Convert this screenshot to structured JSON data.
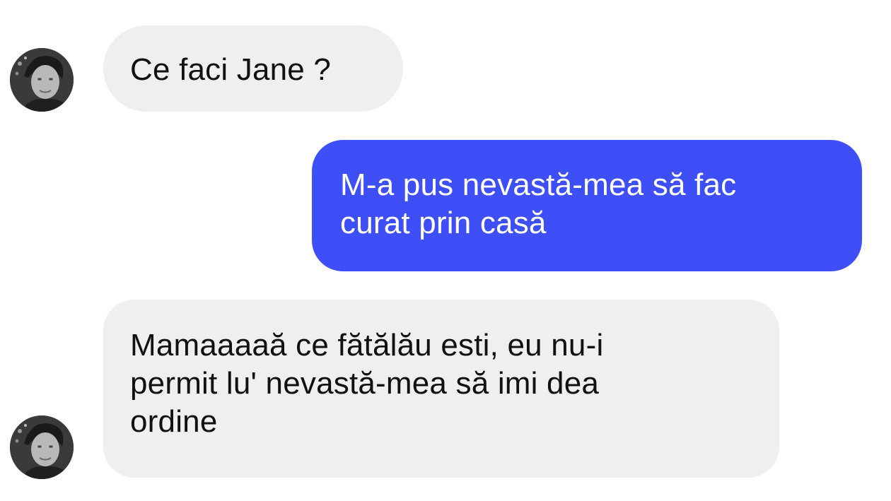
{
  "conversation": {
    "messages": [
      {
        "sender": "contact",
        "lines": [
          "Ce faci Jane ?"
        ]
      },
      {
        "sender": "self",
        "lines": [
          "M-a pus nevastă-mea să fac",
          "curat prin casă"
        ]
      },
      {
        "sender": "contact",
        "lines": [
          "Mamaaaaă ce fătălău esti, eu nu-i",
          "permit lu' nevastă-mea să imi dea",
          "ordine"
        ]
      }
    ]
  },
  "colors": {
    "incoming_bubble": "#efeff1",
    "outgoing_bubble": "#3e4ff7",
    "incoming_text": "#111111",
    "outgoing_text": "#ffffff"
  }
}
